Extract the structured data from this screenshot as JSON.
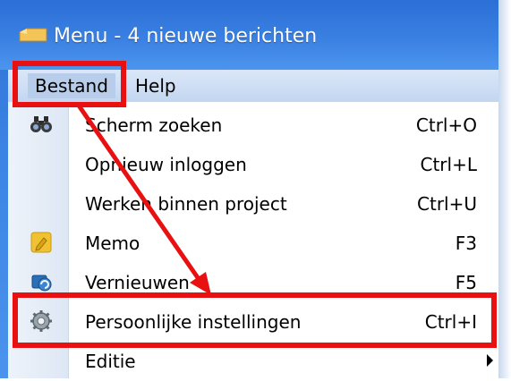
{
  "window": {
    "title": "Menu - 4 nieuwe berichten"
  },
  "menubar": {
    "items": [
      {
        "label": "Bestand"
      },
      {
        "label": "Help"
      }
    ]
  },
  "menu": {
    "items": [
      {
        "label": "Scherm zoeken",
        "shortcut": "Ctrl+O",
        "icon": "binoculars-icon"
      },
      {
        "label": "Opnieuw inloggen",
        "shortcut": "Ctrl+L",
        "icon": ""
      },
      {
        "label": "Werken binnen project",
        "shortcut": "Ctrl+U",
        "icon": ""
      },
      {
        "label": "Memo",
        "shortcut": "F3",
        "icon": "memo-icon"
      },
      {
        "label": "Vernieuwen",
        "shortcut": "F5",
        "icon": "refresh-icon"
      },
      {
        "label": "Persoonlijke instellingen",
        "shortcut": "Ctrl+I",
        "icon": "gear-icon"
      },
      {
        "label": "Editie",
        "shortcut": "",
        "icon": ""
      }
    ]
  },
  "annotation": {
    "color": "#e81010"
  }
}
